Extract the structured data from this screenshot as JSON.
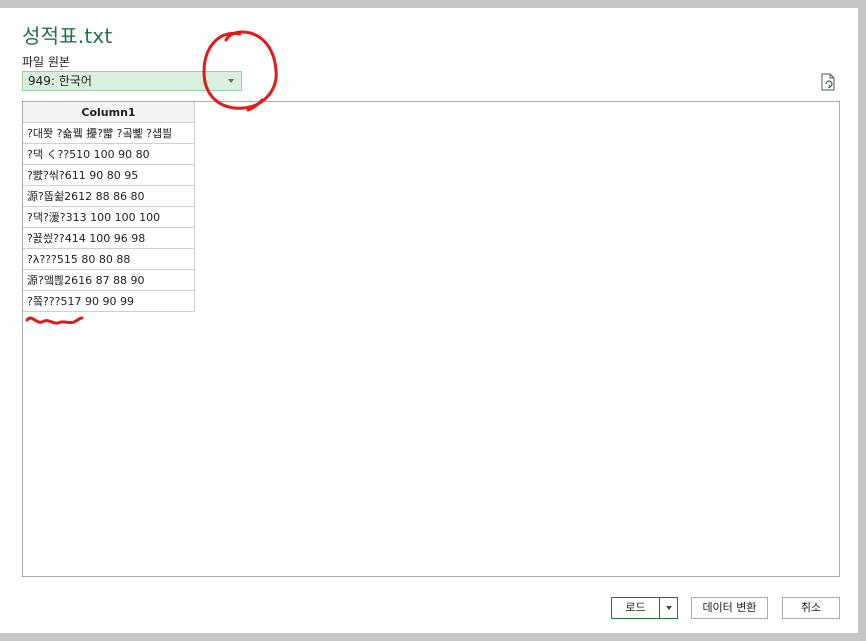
{
  "dialog": {
    "title": "성적표.txt",
    "file_origin_label": "파일 원본",
    "encoding_value": "949: 한국어"
  },
  "table": {
    "header": "Column1",
    "rows": [
      "?대쫫 ?숇뀈 擾?뺣 ?곸뼱 ?섑븰",
      "?댁 く??510 100 90 80",
      "?뺤?씪?611 90 80 95",
      "源?뚭쉶2612 88 86 80",
      "?댁?湲?313 100 100 100",
      "?꾨씠??414 100 96 98",
      "?λ???515 80 80 88",
      "源?앸쁺2616 87 88 90",
      "?쫔???517 90 90 99"
    ]
  },
  "buttons": {
    "load": "로드",
    "transform": "데이터 변환",
    "cancel": "취소"
  },
  "colors": {
    "title": "#217346",
    "select_bg": "#d9f0de",
    "annotation": "#e01b1b"
  },
  "icons": {
    "refresh": "refresh-icon",
    "dropdown": "chevron-down-icon"
  }
}
